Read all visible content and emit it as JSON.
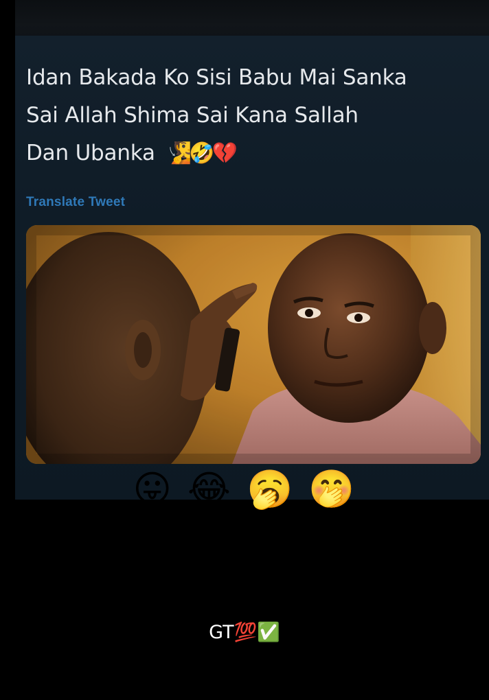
{
  "tweet": {
    "text_lines": [
      "Idan Bakada Ko Sisi Babu Mai Sanka",
      "Sai Allah Shima Sai Kana Sallah",
      "Dan Ubanka"
    ],
    "text_emojis": "🧏🤣💔",
    "translate_link": "Translate Tweet",
    "media": {
      "icon": "video-still-image"
    }
  },
  "reactions": {
    "emojis": [
      "😛",
      "😂",
      "🥱",
      "🤭"
    ]
  },
  "caption": {
    "text": "GT",
    "emojis": "💯✅"
  },
  "colors": {
    "background": "#000000",
    "card": "#0f1c27",
    "tweet_text": "#e6e9ec",
    "link": "#2f79b8"
  }
}
